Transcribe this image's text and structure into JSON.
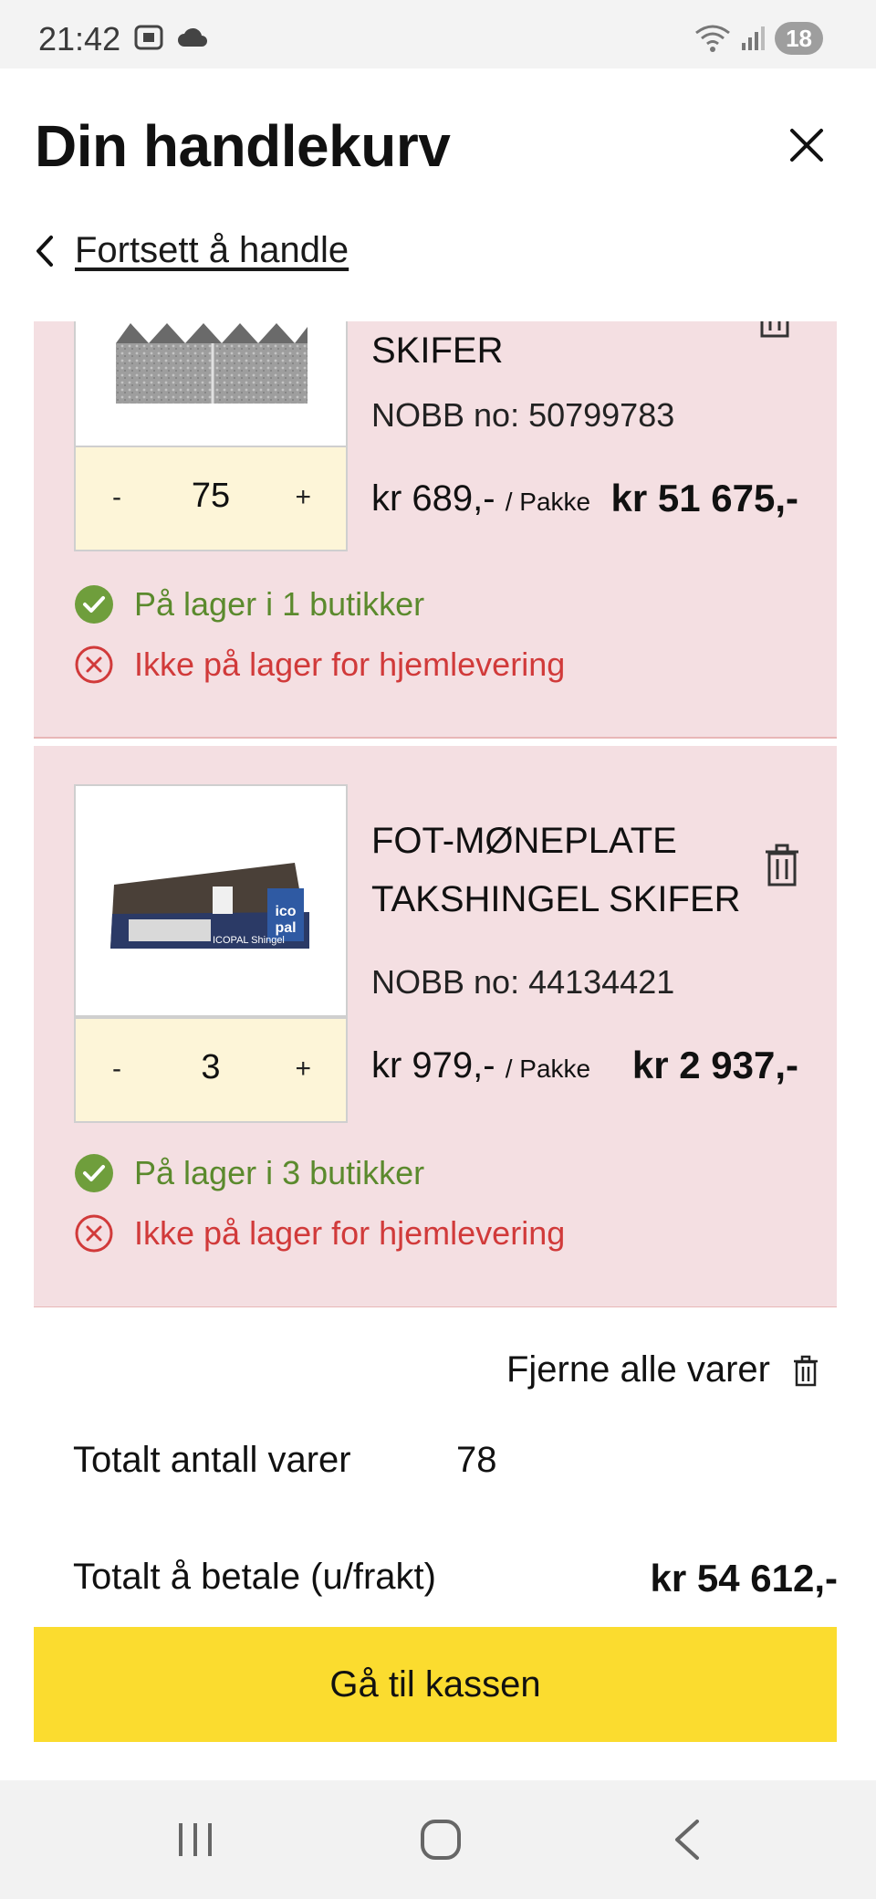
{
  "status_bar": {
    "time": "21:42",
    "battery": "18"
  },
  "header": {
    "title": "Din handlekurv",
    "back_label": "Fortsett å handle"
  },
  "items": [
    {
      "name_visible": "SKIFER",
      "nobb": "NOBB no: 50799783",
      "quantity": "75",
      "unit_price": "kr 689,-",
      "unit": "/ Pakke",
      "total": "kr 51 675,-",
      "stock_store": "På lager i 1 butikker",
      "stock_delivery": "Ikke på lager for hjemlevering"
    },
    {
      "name_line1": "FOT-MØNEPLATE",
      "name_line2": "TAKSHINGEL SKIFER",
      "nobb": "NOBB no: 44134421",
      "quantity": "3",
      "unit_price": "kr 979,-",
      "unit": "/ Pakke",
      "total": "kr 2 937,-",
      "stock_store": "På lager i 3 butikker",
      "stock_delivery": "Ikke på lager for hjemlevering",
      "image_brand": "ICOPAL Shingel"
    }
  ],
  "qty_controls": {
    "minus": "-",
    "plus": "+"
  },
  "summary": {
    "remove_all": "Fjerne alle varer",
    "count_label": "Totalt antall varer",
    "count_value": "78",
    "total_label": "Totalt å betale (u/frakt)",
    "total_value": "kr 54 612,-"
  },
  "checkout_label": "Gå til kassen",
  "colors": {
    "item_bg": "#f4dfe2",
    "qty_bg": "#fdf5d8",
    "checkout": "#fbdc2f",
    "in_stock": "#5b8a2d",
    "out_of_stock": "#d13a3a"
  }
}
